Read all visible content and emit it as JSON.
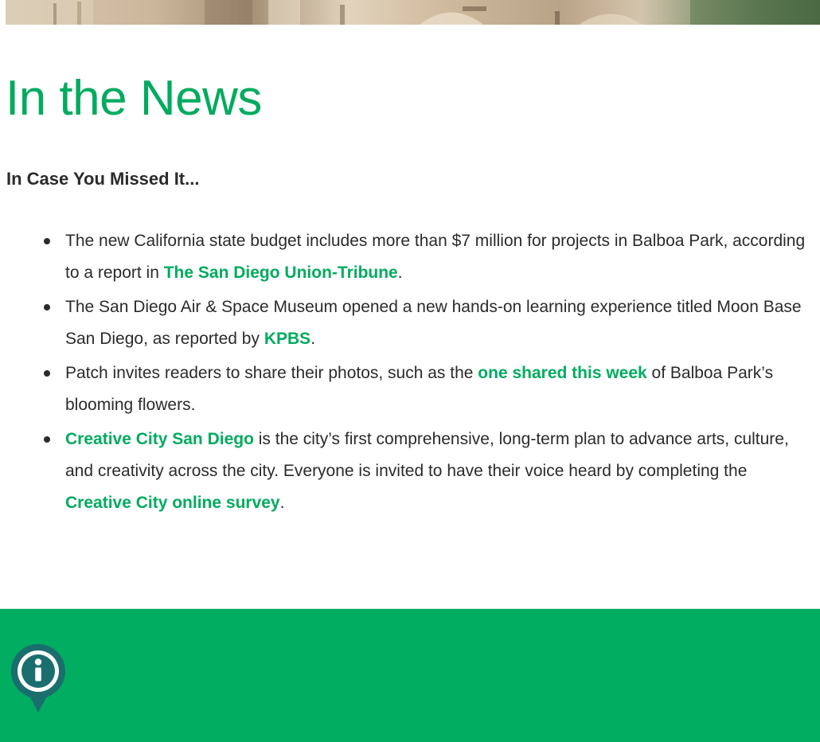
{
  "header": {
    "hero_image_alt": "Balboa Park architecture"
  },
  "main": {
    "title": "In the News",
    "subtitle": "In Case You Missed It...",
    "items": [
      {
        "before": "The new California state budget includes more than $7 million for projects in Balboa Park, according to a report in ",
        "link": "The San Diego Union-Tribune",
        "after": "."
      },
      {
        "before": "The San Diego Air & Space Museum opened a new hands-on learning experience titled Moon Base San Diego, as reported by ",
        "link": "KPBS",
        "after": "."
      },
      {
        "before": "Patch invites readers to share their photos, such as the ",
        "link": "one shared this week",
        "after": " of Balboa Park’s blooming flowers."
      },
      {
        "before": "",
        "link": "Creative City San Diego",
        "middle": " is the city’s first comprehensive, long-term plan to advance arts, culture, and creativity across the city. Everyone is invited to have their voice heard by completing the ",
        "link2": "Creative City online survey",
        "after": "."
      }
    ]
  },
  "footer": {
    "icon": "info-pin-icon"
  },
  "colors": {
    "accent": "#00ab5f",
    "footer_bg": "#00ad61",
    "text": "#2b2b2b",
    "pin": "#1a6e6e"
  }
}
